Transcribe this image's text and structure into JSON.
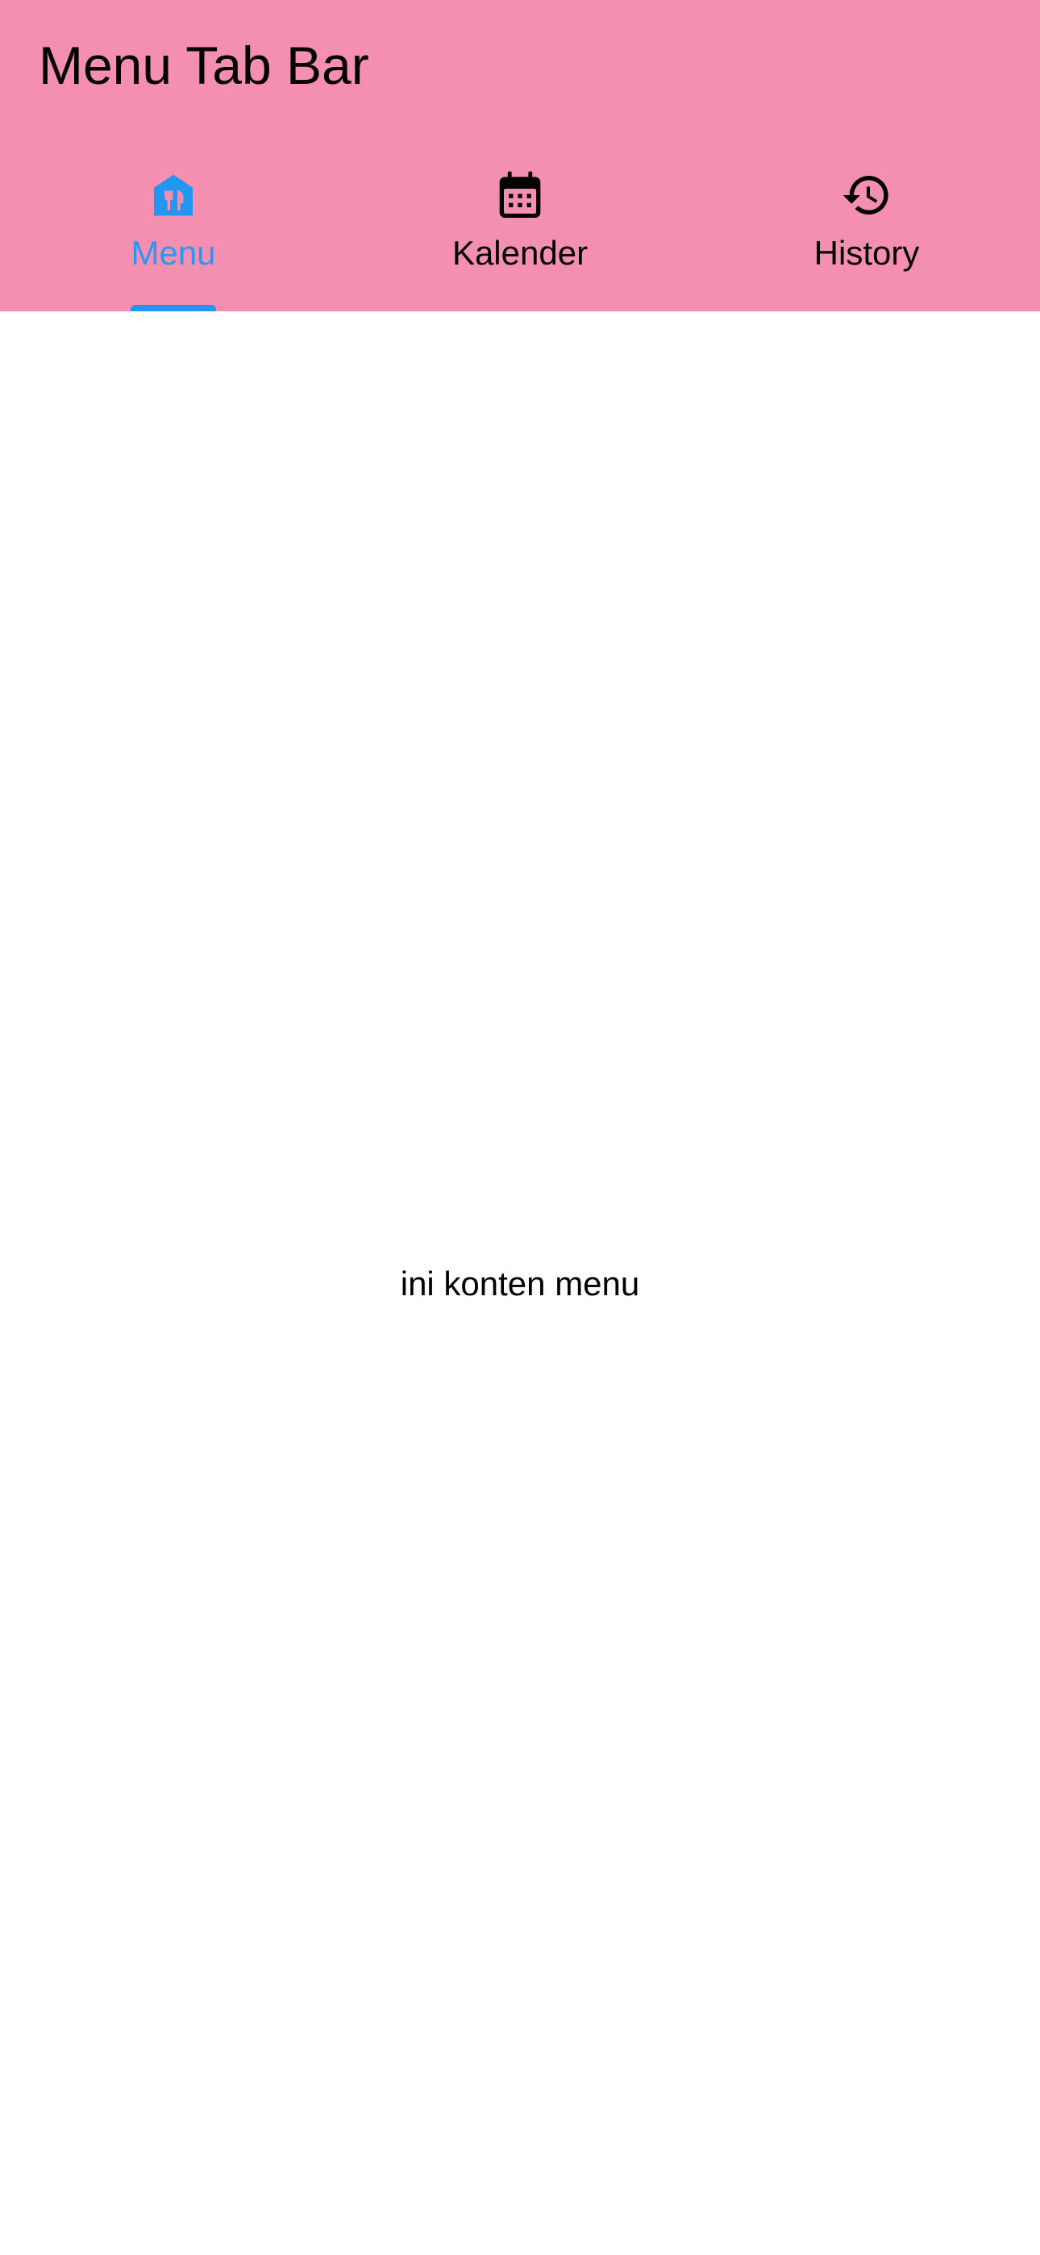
{
  "appbar": {
    "title": "Menu Tab Bar",
    "background_color": "#f48fb1"
  },
  "tabs": [
    {
      "label": "Menu",
      "icon": "restaurant-house-icon",
      "active": true
    },
    {
      "label": "Kalender",
      "icon": "calendar-icon",
      "active": false
    },
    {
      "label": "History",
      "icon": "history-icon",
      "active": false
    }
  ],
  "colors": {
    "active_tab": "#2196f3",
    "inactive_tab": "#000000"
  },
  "content": {
    "text": "ini konten menu"
  }
}
